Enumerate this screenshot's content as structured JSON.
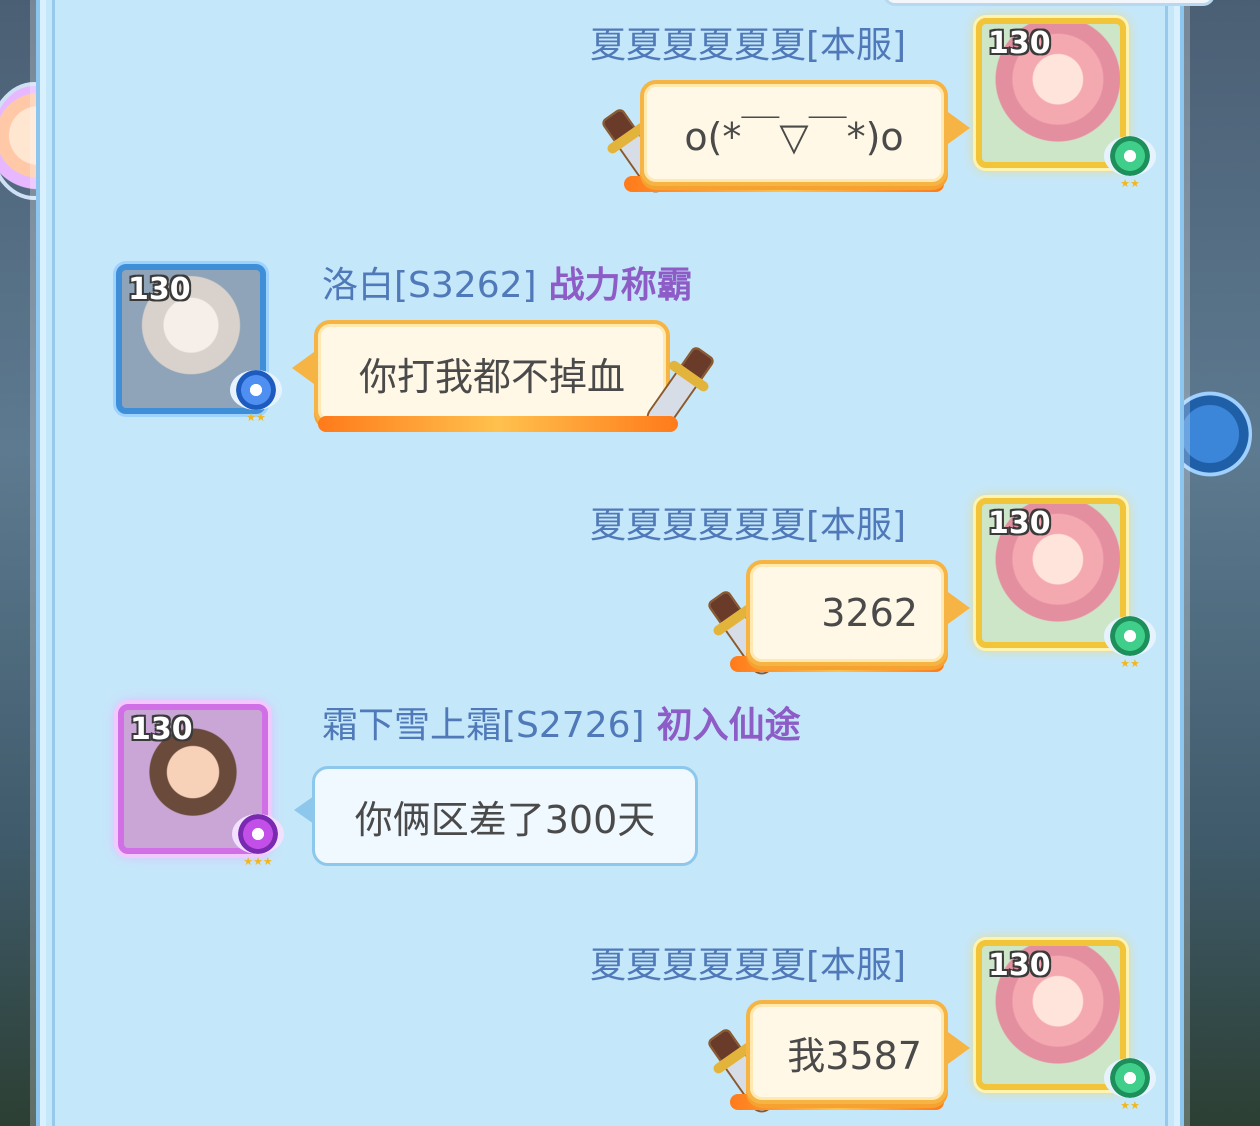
{
  "background": {
    "mascot_icon": "mascot-avatar-icon",
    "side_button_icon": "round-nav-button-icon"
  },
  "messages": [
    {
      "side": "right",
      "sender": "夏夏夏夏夏夏[本服]",
      "title": "",
      "level": "130",
      "text": "o(*￣▽￣*)o",
      "bubble_style": "gold"
    },
    {
      "side": "left",
      "sender": "洛白[S3262]",
      "title": "战力称霸",
      "level": "130",
      "text": "你打我都不掉血",
      "bubble_style": "gold"
    },
    {
      "side": "right",
      "sender": "夏夏夏夏夏夏[本服]",
      "title": "",
      "level": "130",
      "text": "3262",
      "bubble_style": "gold"
    },
    {
      "side": "left",
      "sender": "霜下雪上霜[S2726]",
      "title": "初入仙途",
      "level": "130",
      "text": "你俩区差了300天",
      "bubble_style": "plain"
    },
    {
      "side": "right",
      "sender": "夏夏夏夏夏夏[本服]",
      "title": "",
      "level": "130",
      "text": "我3587",
      "bubble_style": "gold"
    }
  ],
  "colors": {
    "panel": "#c5e7fa",
    "name": "#4f79b8",
    "title": "#8d5cc7",
    "gold_border": "#f6b444",
    "plain_border": "#8dc7ec"
  },
  "rank_stars": {
    "gold": "★★",
    "blue": "★★",
    "purple": "★★★"
  }
}
